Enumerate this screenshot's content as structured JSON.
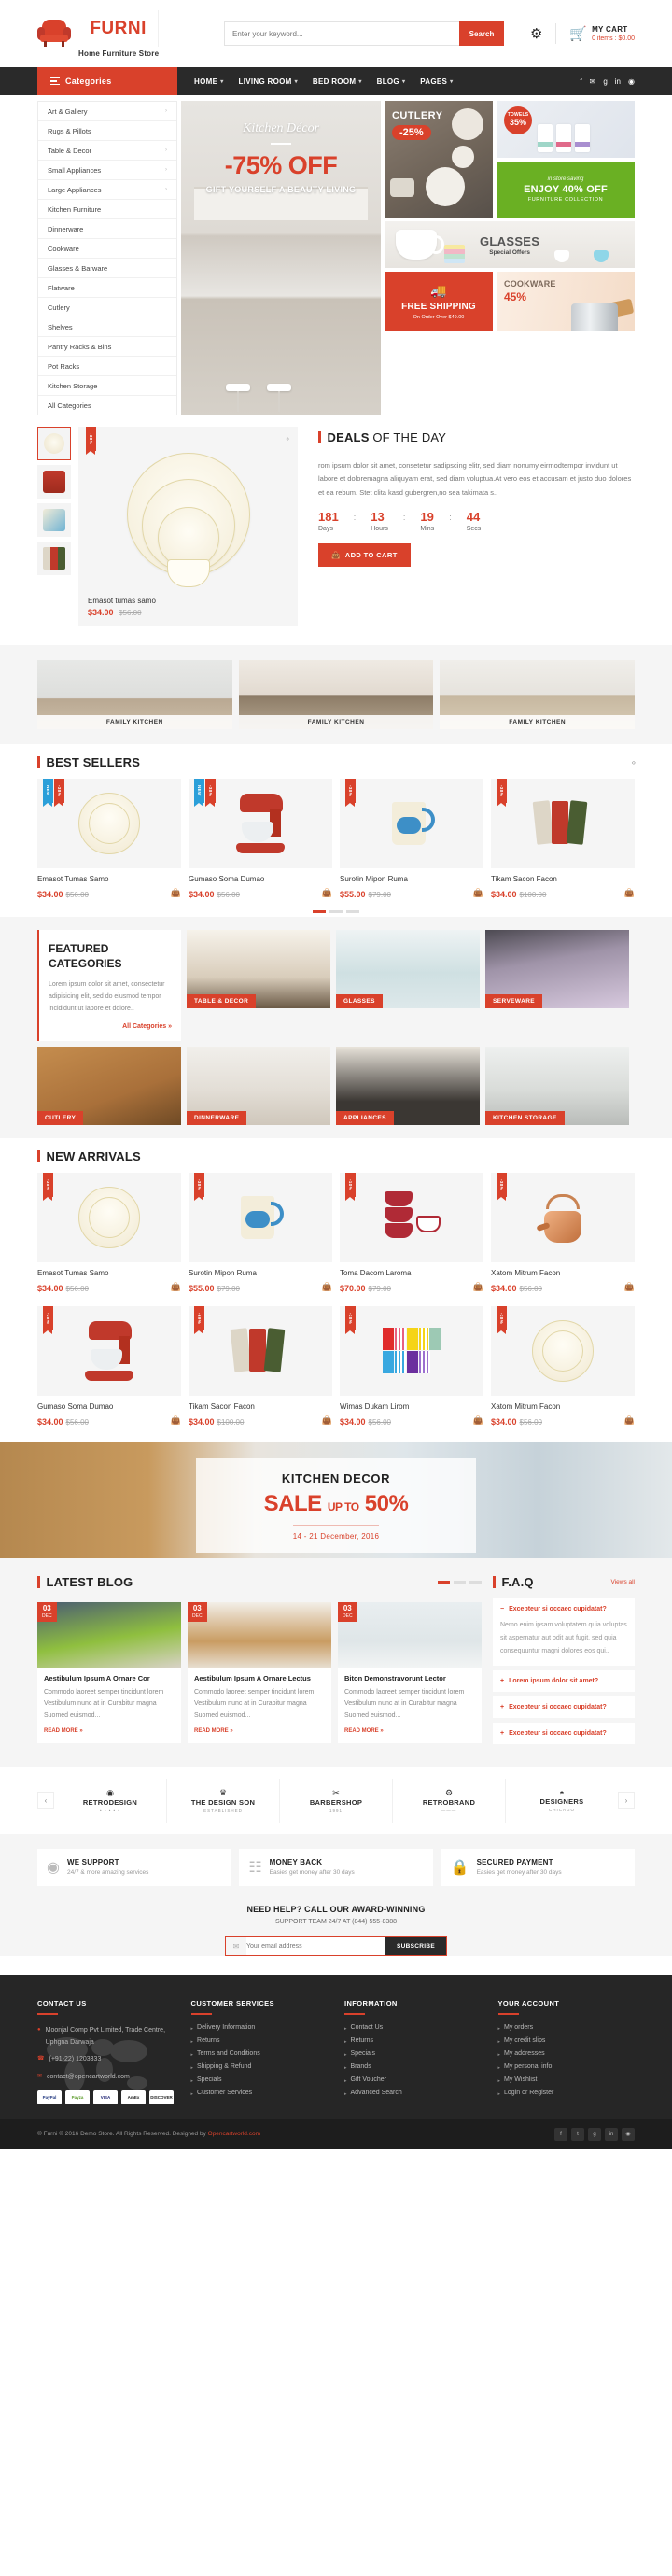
{
  "header": {
    "brand": "FURNI",
    "tagline": "Home Furniture Store",
    "search_placeholder": "Enter your keyword...",
    "search_value": "",
    "search_button": "Search",
    "gear_icon": "gear-icon",
    "cart_label": "MY CART",
    "cart_sub": "0 items : $0.00"
  },
  "nav": {
    "categories_label": "Categories",
    "items": [
      {
        "label": "HOME",
        "caret": "▾"
      },
      {
        "label": "LIVING ROOM",
        "caret": "▾"
      },
      {
        "label": "BED ROOM",
        "caret": "▾"
      },
      {
        "label": "BLOG",
        "caret": "▾"
      },
      {
        "label": "PAGES",
        "caret": "▾"
      }
    ],
    "social": [
      "f",
      "✉",
      "g",
      "in",
      "◉"
    ]
  },
  "sidebar": {
    "items": [
      {
        "label": "Art & Gallery",
        "arrow": "›"
      },
      {
        "label": "Rugs & Pillots",
        "arrow": ""
      },
      {
        "label": "Table & Decor",
        "arrow": "›"
      },
      {
        "label": "Small Appliances",
        "arrow": "›"
      },
      {
        "label": "Large Appliances",
        "arrow": "›"
      },
      {
        "label": "Kitchen Furniture",
        "arrow": ""
      },
      {
        "label": "Dinnerware",
        "arrow": ""
      },
      {
        "label": "Cookware",
        "arrow": ""
      },
      {
        "label": "Glasses & Barware",
        "arrow": ""
      },
      {
        "label": "Flatware",
        "arrow": ""
      },
      {
        "label": "Cutlery",
        "arrow": ""
      },
      {
        "label": "Shelves",
        "arrow": ""
      },
      {
        "label": "Pantry Racks & Bins",
        "arrow": ""
      },
      {
        "label": "Pot Racks",
        "arrow": ""
      },
      {
        "label": "Kitchen Storage",
        "arrow": ""
      },
      {
        "label": "All Categories",
        "arrow": ""
      }
    ]
  },
  "hero": {
    "slider": {
      "script": "Kitchen Décor",
      "headline": "-75% OFF",
      "sub": "GIFT YOURSELF A BEAUTY LIVING"
    },
    "cutlery": {
      "title": "CUTLERY",
      "discount": "-25%"
    },
    "towels": {
      "label": "TOWELS",
      "percent": "35%"
    },
    "green": {
      "small": "in store saving",
      "big": "ENJOY 40% OFF",
      "sub": "FURNITURE COLLECTION"
    },
    "glasses": {
      "title_a": "GLA",
      "title_b": "SSES",
      "sub": "Special Offers"
    },
    "freeship": {
      "icon": "truck-icon",
      "title": "FREE SHIPPING",
      "sub": "On Order Over $49.00"
    },
    "cookware": {
      "title_a": "COOK",
      "title_b": "WARE",
      "percent": "45%"
    }
  },
  "deals": {
    "section_title_a": "DEALS",
    "section_title_b": "OF THE DAY",
    "product_name": "Emasot tumas samo",
    "price_new": "$34.00",
    "price_old": "$56.00",
    "ribbon": "-38%",
    "description": "rom ipsum dolor sit amet, consetetur sadipscing elitr, sed diam nonumy eirmodtempor invidunt ut labore et doloremagna aliquyam erat, sed diam voluptua.At vero eos et accusam et justo duo dolores et ea rebum. Stet clita kasd gubergren,no sea takimata s..",
    "countdown": [
      {
        "n": "181",
        "l": "Days"
      },
      {
        "n": "13",
        "l": "Hours"
      },
      {
        "n": "19",
        "l": "Mins"
      },
      {
        "n": "44",
        "l": "Secs"
      }
    ],
    "add_to_cart": "ADD TO CART",
    "nav_arrows": "‹›"
  },
  "family_kitchen": [
    {
      "label": "FAMILY KITCHEN"
    },
    {
      "label": "FAMILY KITCHEN"
    },
    {
      "label": "FAMILY KITCHEN"
    }
  ],
  "best_sellers": {
    "title": "BEST SELLERS",
    "nav_arrows": "‹›",
    "products": [
      {
        "name": "Emasot Tumas Samo",
        "new": "$34.00",
        "old": "$56.00",
        "ribbons": [
          "NEW",
          "-38%"
        ],
        "art": "plate"
      },
      {
        "name": "Gumaso Soma Dumao",
        "new": "$34.00",
        "old": "$56.00",
        "ribbons": [
          "NEW",
          "-38%"
        ],
        "art": "mixer"
      },
      {
        "name": "Surotin Mipon Ruma",
        "new": "$55.00",
        "old": "$79.00",
        "ribbons": [
          "-38%"
        ],
        "art": "mug"
      },
      {
        "name": "Tikam Sacon Facon",
        "new": "$34.00",
        "old": "$100.00",
        "ribbons": [
          "-38%"
        ],
        "art": "towels"
      }
    ]
  },
  "featured": {
    "title_line1": "FEATURED",
    "title_line2": "CATEGORIES",
    "desc": "Lorem ipsum dolor sit amet, consectetur adipisicing elit, sed do eiusmod tempor incididunt ut labore et dolore..",
    "link": "All Categories »",
    "cats": [
      {
        "label": "TABLE & DECOR"
      },
      {
        "label": "GLASSES"
      },
      {
        "label": "SERVEWARE"
      },
      {
        "label": "CUTLERY"
      },
      {
        "label": "DINNERWARE"
      },
      {
        "label": "APPLIANCES"
      },
      {
        "label": "KITCHEN STORAGE"
      }
    ]
  },
  "new_arrivals": {
    "title": "NEW ARRIVALS",
    "row1": [
      {
        "name": "Emasot Tumas Samo",
        "new": "$34.00",
        "old": "$56.00",
        "ribbon": "-38%",
        "art": "plate"
      },
      {
        "name": "Surotin Mipon Ruma",
        "new": "$55.00",
        "old": "$79.00",
        "ribbon": "-38%",
        "art": "mug"
      },
      {
        "name": "Toma Dacom Laroma",
        "new": "$70.00",
        "old": "$79.00",
        "ribbon": "-10%",
        "art": "bowls"
      },
      {
        "name": "Xatom Mitrum Facon",
        "new": "$34.00",
        "old": "$56.00",
        "ribbon": "-38%",
        "art": "kettle"
      }
    ],
    "row2": [
      {
        "name": "Gumaso Soma Dumao",
        "new": "$34.00",
        "old": "$56.00",
        "ribbon": "-38%",
        "art": "mixer"
      },
      {
        "name": "Tikam Sacon Facon",
        "new": "$34.00",
        "old": "$100.00",
        "ribbon": "-69%",
        "art": "towels"
      },
      {
        "name": "Wimas Dukam Lirom",
        "new": "$34.00",
        "old": "$56.00",
        "ribbon": "-38%",
        "art": "rags"
      },
      {
        "name": "Xatom Mitrum Facon",
        "new": "$34.00",
        "old": "$56.00",
        "ribbon": "-38%",
        "art": "plate"
      }
    ]
  },
  "sale_banner": {
    "title": "KITCHEN DECOR",
    "sale_word": "SALE",
    "upto": "UP TO",
    "percent": "50%",
    "dates": "14 - 21 December, 2016"
  },
  "blog": {
    "title": "LATEST BLOG",
    "posts": [
      {
        "day": "03",
        "month": "DEC",
        "title": "Aestibulum Ipsum A Ornare Cor",
        "excerpt": "Commodo laoreet semper tincidunt lorem Vestibulum nunc at in Curabitur magna Suomed euismod...",
        "more": "READ MORE »"
      },
      {
        "day": "03",
        "month": "DEC",
        "title": "Aestibulum Ipsum A Ornare Lectus",
        "excerpt": "Commodo laoreet semper tincidunt lorem Vestibulum nunc at in Curabitur magna Suomed euismod...",
        "more": "READ MORE »"
      },
      {
        "day": "03",
        "month": "DEC",
        "title": "Biton Demonstravorunt Lector",
        "excerpt": "Commodo laoreet semper tincidunt lorem Vestibulum nunc at in Curabitur magna Suomed euismod...",
        "more": "READ MORE »"
      }
    ]
  },
  "faq": {
    "title": "F.A.Q",
    "view_all": "Views all",
    "items": [
      {
        "sign": "−",
        "q": "Excepteur si occaec cupidatat?",
        "a": "Nemo enim ipsam voluptatem quia voluptas sit aspernatur aut odit aut fugit, sed quia consequuntur magni dolores eos qui..",
        "open": true
      },
      {
        "sign": "+",
        "q": "Lorem ipsum dolor sit amet?",
        "a": "",
        "open": false
      },
      {
        "sign": "+",
        "q": "Excepteur si occaec cupidatat?",
        "a": "",
        "open": false
      },
      {
        "sign": "+",
        "q": "Excepteur si occaec cupidatat?",
        "a": "",
        "open": false
      }
    ]
  },
  "brands": {
    "prev": "‹",
    "next": "›",
    "items": [
      {
        "name": "RETRODESIGN",
        "mark": "◉",
        "sub": "• • • • •"
      },
      {
        "name": "THE DESIGN SON",
        "mark": "♛",
        "sub": "ESTABLISHED"
      },
      {
        "name": "BARBERSHOP",
        "mark": "✂",
        "sub": "1991"
      },
      {
        "name": "RETROBRAND",
        "mark": "⚙",
        "sub": "———"
      },
      {
        "name": "DESIGNERS",
        "mark": "◓",
        "sub": "CHICAGO"
      }
    ]
  },
  "services": [
    {
      "icon": "lifebuoy-icon",
      "glyph": "◎",
      "title": "WE SUPPORT",
      "sub": "24/7 & more amazing services"
    },
    {
      "icon": "money-icon",
      "glyph": "▤",
      "title": "MONEY BACK",
      "sub": "Easies get money after 30 days"
    },
    {
      "icon": "lock-icon",
      "glyph": "ὑ2",
      "title": "SECURED PAYMENT",
      "sub": "Easies get money after 30 days"
    }
  ],
  "newsletter": {
    "headline": "NEED HELP? CALL OUR AWARD-WINNING",
    "sub": "SUPPORT TEAM 24/7 AT (844) 555-8388",
    "email_icon": "envelope-icon",
    "placeholder": "Your email address",
    "value": "",
    "button": "SUBSCRIBE"
  },
  "footer": {
    "contact": {
      "title": "CONTACT US",
      "address_icon": "location-icon",
      "address": "Moonjal Comp Pvt Limited, Trade Centre, Uphgna Darwaja",
      "phone_icon": "phone-icon",
      "phone": "(+91-22) 1203333",
      "mail_icon": "mail-icon",
      "email": "contact@opencartworld.com",
      "payments": [
        "PayPal",
        "Payza",
        "VISA",
        "AmEx",
        "DISCOVER"
      ]
    },
    "columns": [
      {
        "title": "CUSTOMER SERVICES",
        "links": [
          "Delivery Information",
          "Returns",
          "Terms and Conditions",
          "Shipping & Refund",
          "Specials",
          "Customer Services"
        ]
      },
      {
        "title": "INFORMATION",
        "links": [
          "Contact Us",
          "Returns",
          "Specials",
          "Brands",
          "Gift Voucher",
          "Advanced Search"
        ]
      },
      {
        "title": "YOUR ACCOUNT",
        "links": [
          "My orders",
          "My credit slips",
          "My addresses",
          "My personal info",
          "My Wishlist",
          "Login or Register"
        ]
      }
    ]
  },
  "copyright": {
    "text_before": "© Furni © 2016 Demo Store. All Rights Reserved. Designed by ",
    "link": "Opencartworld.com",
    "social": [
      "f",
      "t",
      "g",
      "in",
      "◉"
    ]
  }
}
